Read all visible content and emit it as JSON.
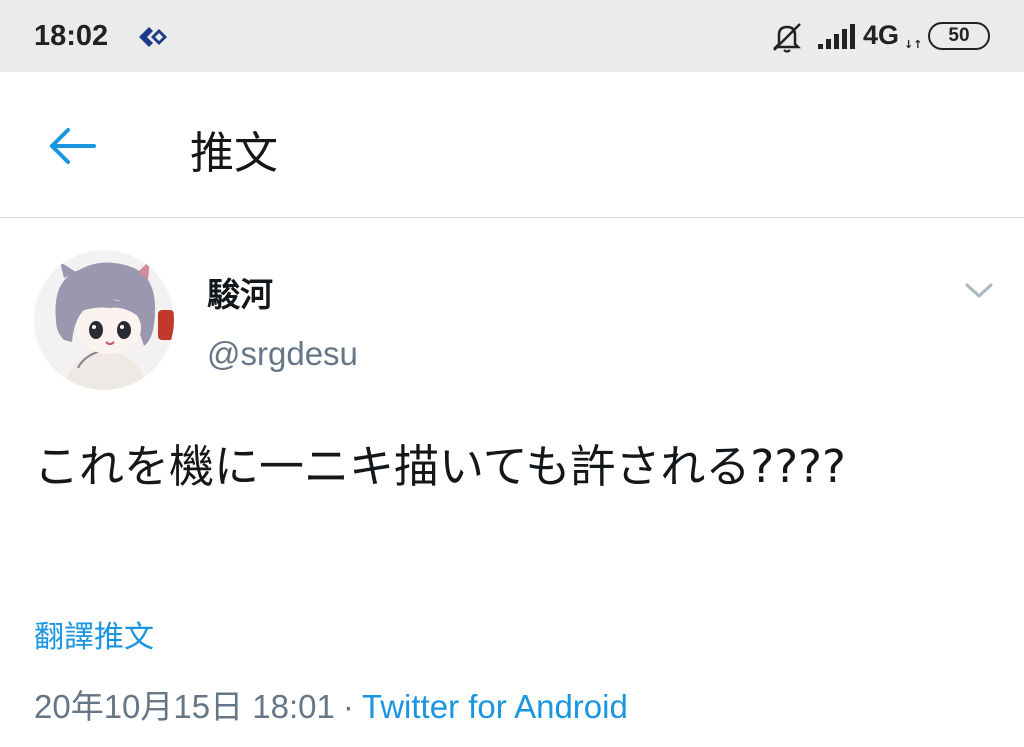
{
  "status_bar": {
    "time": "18:02",
    "network": "4G",
    "data_arrows": "↓↑",
    "battery": "50",
    "icons": [
      "notification-app-icon",
      "mute-icon",
      "signal-icon",
      "battery-icon"
    ]
  },
  "app_bar": {
    "back_icon": "arrow-left-icon",
    "title": "推文"
  },
  "tweet": {
    "display_name": "駿河",
    "handle": "@srgdesu",
    "text": "これを機に一ニキ描いても許される????",
    "translate_label": "翻譯推文",
    "timestamp": "20年10月15日 18:01",
    "separator": "·",
    "source": "Twitter for Android"
  },
  "colors": {
    "accent": "#1b95e0",
    "text_primary": "#14171a",
    "text_secondary": "#657786",
    "status_bar_bg": "#ebebeb"
  }
}
